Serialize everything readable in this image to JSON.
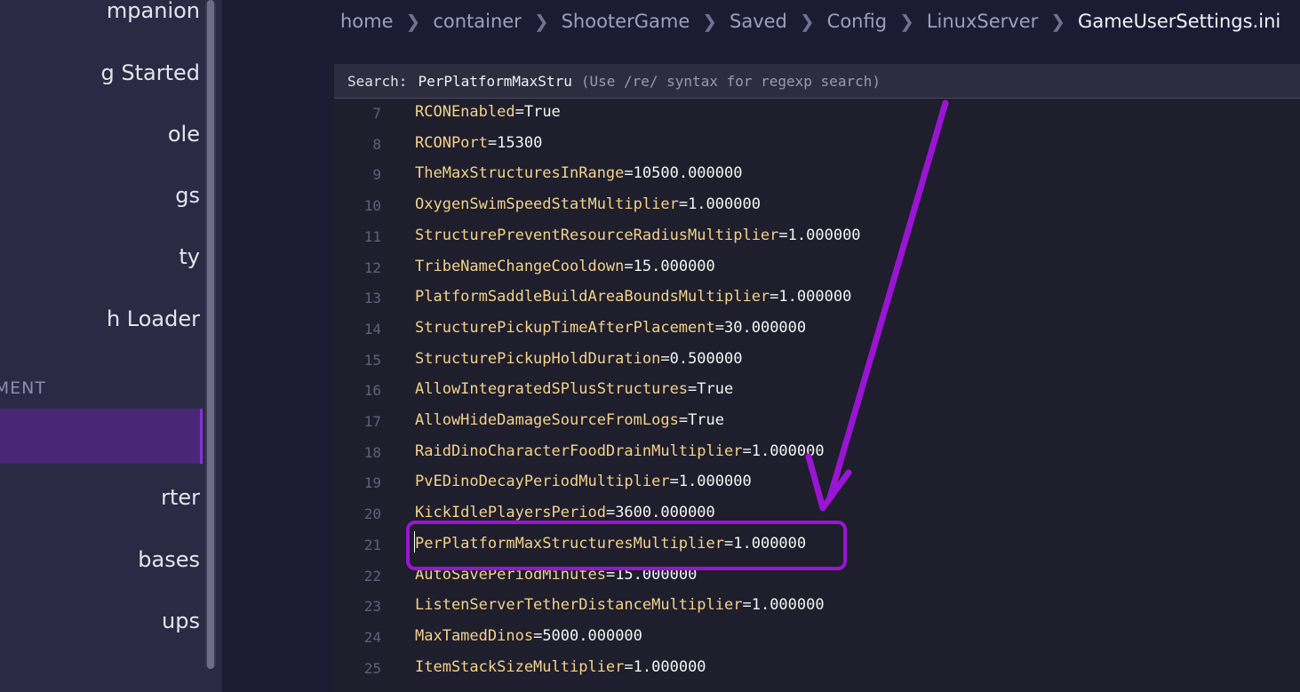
{
  "sidebar": {
    "items": [
      {
        "label": "mpanion"
      },
      {
        "label": "g Started"
      },
      {
        "label": "ole"
      },
      {
        "label": "gs"
      },
      {
        "label": "ty"
      },
      {
        "label": "h Loader"
      },
      {
        "label": ""
      },
      {
        "label": "rter"
      },
      {
        "label": "bases"
      },
      {
        "label": "ups"
      }
    ],
    "section_heading": "MENT"
  },
  "breadcrumb": [
    "home",
    "container",
    "ShooterGame",
    "Saved",
    "Config",
    "LinuxServer",
    "GameUserSettings.ini"
  ],
  "editor": {
    "search_label": "Search:",
    "search_value": "PerPlatformMaxStru",
    "search_hint": "(Use /re/ syntax for regexp search)",
    "lines": [
      {
        "num": "7",
        "key": "RCONEnabled",
        "value": "True"
      },
      {
        "num": "8",
        "key": "RCONPort",
        "value": "15300"
      },
      {
        "num": "9",
        "key": "TheMaxStructuresInRange",
        "value": "10500.000000"
      },
      {
        "num": "10",
        "key": "OxygenSwimSpeedStatMultiplier",
        "value": "1.000000"
      },
      {
        "num": "11",
        "key": "StructurePreventResourceRadiusMultiplier",
        "value": "1.000000"
      },
      {
        "num": "12",
        "key": "TribeNameChangeCooldown",
        "value": "15.000000"
      },
      {
        "num": "13",
        "key": "PlatformSaddleBuildAreaBoundsMultiplier",
        "value": "1.000000"
      },
      {
        "num": "14",
        "key": "StructurePickupTimeAfterPlacement",
        "value": "30.000000"
      },
      {
        "num": "15",
        "key": "StructurePickupHoldDuration",
        "value": "0.500000"
      },
      {
        "num": "16",
        "key": "AllowIntegratedSPlusStructures",
        "value": "True"
      },
      {
        "num": "17",
        "key": "AllowHideDamageSourceFromLogs",
        "value": "True"
      },
      {
        "num": "18",
        "key": "RaidDinoCharacterFoodDrainMultiplier",
        "value": "1.000000"
      },
      {
        "num": "19",
        "key": "PvEDinoDecayPeriodMultiplier",
        "value": "1.000000"
      },
      {
        "num": "20",
        "key": "KickIdlePlayersPeriod",
        "value": "3600.000000"
      },
      {
        "num": "21",
        "key": "PerPlatformMaxStructuresMultiplier",
        "value": "1.000000"
      },
      {
        "num": "22",
        "key": "AutoSavePeriodMinutes",
        "value": "15.000000"
      },
      {
        "num": "23",
        "key": "ListenServerTetherDistanceMultiplier",
        "value": "1.000000"
      },
      {
        "num": "24",
        "key": "MaxTamedDinos",
        "value": "5000.000000"
      },
      {
        "num": "25",
        "key": "ItemStackSizeMultiplier",
        "value": "1.000000"
      }
    ]
  },
  "colors": {
    "accent": "#9a14d4",
    "active_nav": "#4a2776",
    "key_text": "#f3d28a"
  }
}
